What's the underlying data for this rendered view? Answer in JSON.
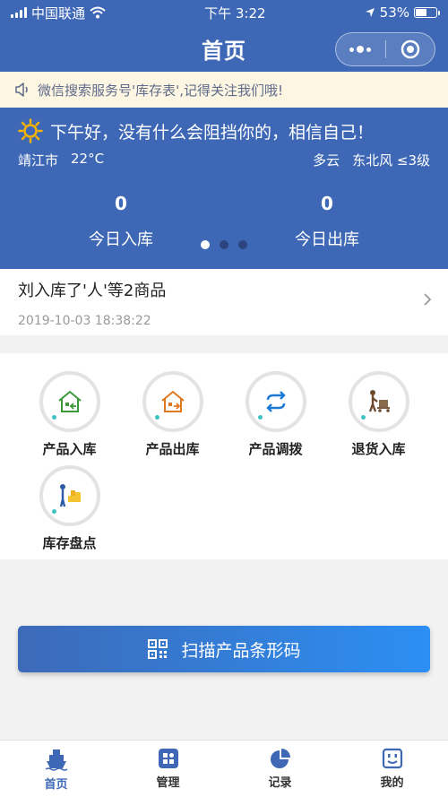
{
  "status_bar": {
    "carrier": "中国联通",
    "time": "下午 3:22",
    "battery": "53%"
  },
  "nav": {
    "title": "首页"
  },
  "notice": {
    "text": "微信搜索服务号'库存表',记得关注我们哦!"
  },
  "weather": {
    "greeting": "下午好，没有什么会阻挡你的，相信自己！",
    "city": "靖江市",
    "temp": "22°C",
    "condition": "多云",
    "wind": "东北风 ≤3级"
  },
  "stats": [
    {
      "value": "0",
      "label": "今日入库"
    },
    {
      "value": "0",
      "label": "今日出库"
    }
  ],
  "carousel": {
    "count": 3,
    "active": 0
  },
  "recent": {
    "text": "刘入库了'人'等2商品",
    "time": "2019-10-03 18:38:22"
  },
  "functions": [
    {
      "label": "产品入库",
      "icon": "house-in-icon"
    },
    {
      "label": "产品出库",
      "icon": "house-out-icon"
    },
    {
      "label": "产品调拨",
      "icon": "transfer-icon"
    },
    {
      "label": "退货入库",
      "icon": "return-cart-icon"
    },
    {
      "label": "库存盘点",
      "icon": "stocktake-icon"
    }
  ],
  "scan_button": {
    "label": "扫描产品条形码"
  },
  "tabs": [
    {
      "label": "首页",
      "icon": "ship-icon",
      "active": true
    },
    {
      "label": "管理",
      "icon": "grid-app-icon",
      "active": false
    },
    {
      "label": "记录",
      "icon": "pie-chart-icon",
      "active": false
    },
    {
      "label": "我的",
      "icon": "face-icon",
      "active": false
    }
  ],
  "colors": {
    "primary": "#3e68b6",
    "notice_bg": "#fdf6e3",
    "sun": "#f4b400"
  }
}
